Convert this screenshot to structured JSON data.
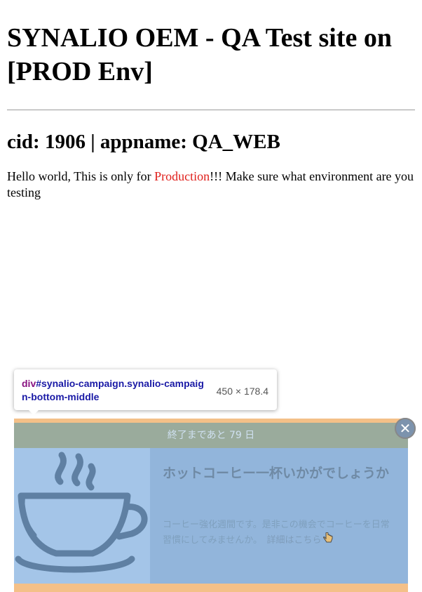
{
  "page": {
    "heading": "SYNALIO OEM - QA Test site on [PROD Env]",
    "subheading": "cid: 1906 | appname: QA_WEB",
    "paragraph_before": "Hello world, This is only for ",
    "paragraph_highlight": "Production",
    "paragraph_after": "!!! Make sure what environment are you testing"
  },
  "inspector": {
    "selector_tag": "div",
    "selector_rest": "#synalio-campaign.synalio-campaign-bottom-middle",
    "size": "450 × 178.4"
  },
  "campaign": {
    "countdown": "終了まであと 79 日",
    "title": "ホットコーヒー一杯いかがでしょうか",
    "body": "コーヒー強化週間です。是非この機会でコーヒーを日常習慣にしてみませんか。",
    "link": "詳細はこちら",
    "close_symbol": "✕",
    "image_icon": "coffee-cup-icon"
  },
  "colors": {
    "production": "#e0201c",
    "campaign_border": "#f4c088",
    "countdown_bar": "#9aab9c",
    "text_panel": "#92b5db"
  }
}
